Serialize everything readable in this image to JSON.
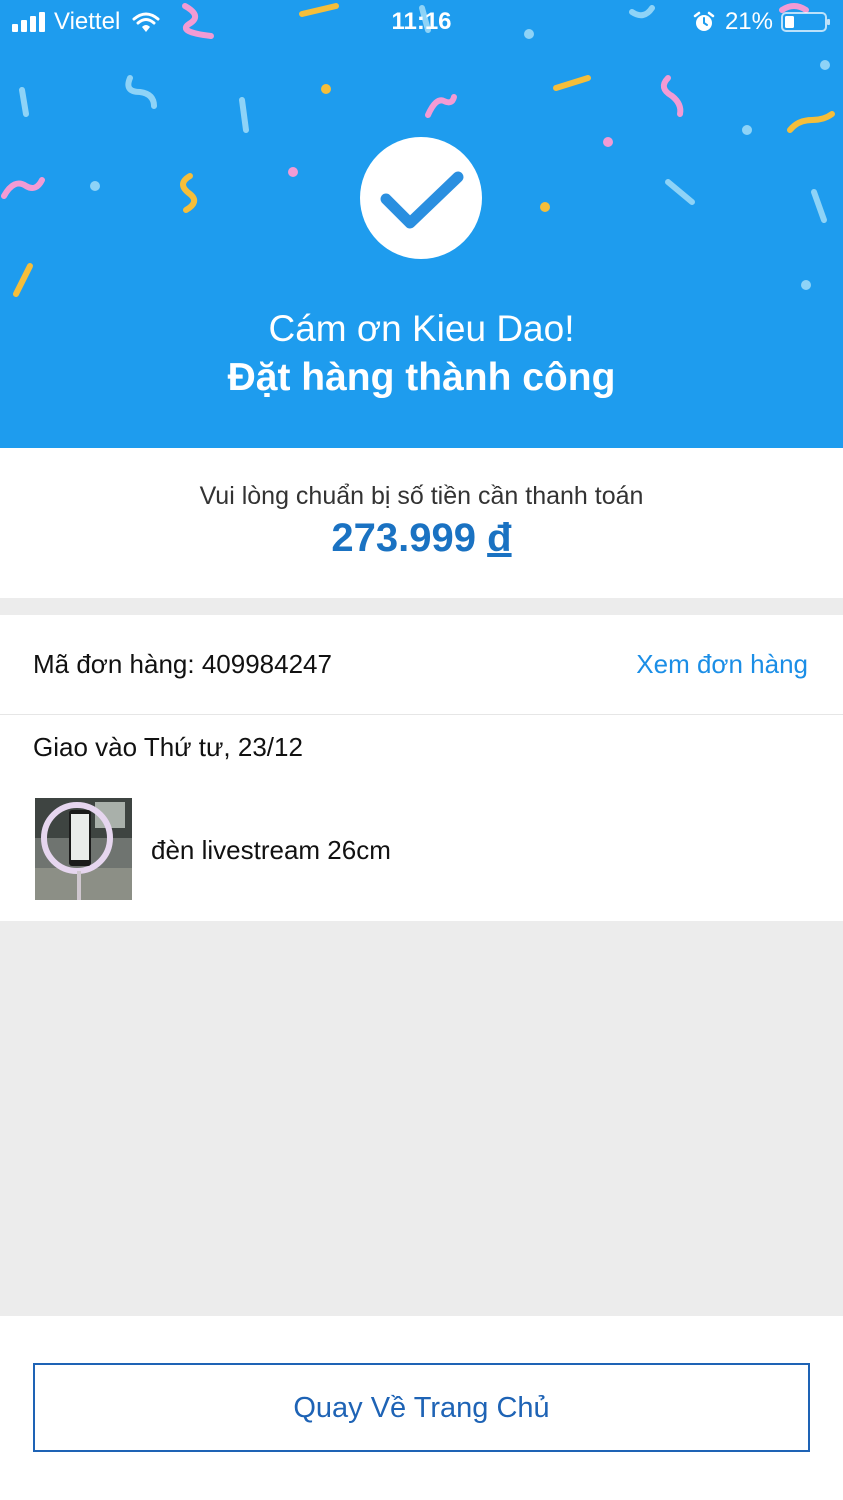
{
  "status_bar": {
    "carrier": "Viettel",
    "time": "11:16",
    "battery": "21%"
  },
  "hero": {
    "thanks": "Cám ơn Kieu Dao!",
    "success": "Đặt hàng thành công"
  },
  "payment": {
    "label": "Vui lòng chuẩn bị số tiền cần thanh toán",
    "amount": "273.999",
    "currency": "đ"
  },
  "order": {
    "id_text": "Mã đơn hàng: 409984247",
    "view_link": "Xem đơn hàng",
    "delivery": "Giao vào Thứ tư, 23/12",
    "product_name": "đèn livestream 26cm"
  },
  "footer": {
    "home_button": "Quay Về Trang Chủ"
  },
  "colors": {
    "hero_bg": "#1e9cee",
    "amount": "#1a72c2",
    "link": "#1b8ee6",
    "button": "#1e63b5"
  }
}
